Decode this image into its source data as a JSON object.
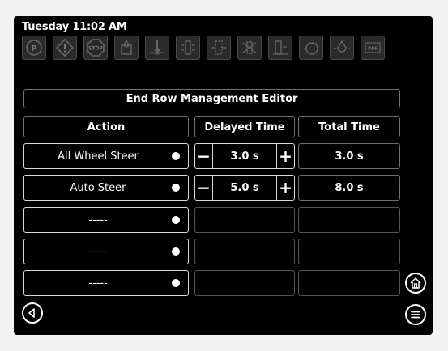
{
  "status": {
    "clock": "Tuesday 11:02 AM"
  },
  "indicators": [
    {
      "icon": "park-brake-icon"
    },
    {
      "icon": "warning-icon"
    },
    {
      "icon": "stop-icon",
      "text": "STOP"
    },
    {
      "icon": "hydraulic-oil-icon"
    },
    {
      "icon": "coolant-temp-icon"
    },
    {
      "icon": "filter-icon"
    },
    {
      "icon": "filter-restriction-icon"
    },
    {
      "icon": "air-filter-icon"
    },
    {
      "icon": "fuel-filter-icon"
    },
    {
      "icon": "engine-icon"
    },
    {
      "icon": "oil-pressure-icon"
    },
    {
      "icon": "def-icon",
      "text": "DEF"
    }
  ],
  "editor": {
    "title": "End Row Management Editor",
    "headers": {
      "action": "Action",
      "delayed": "Delayed Time",
      "total": "Total Time"
    },
    "rows": [
      {
        "action": "All Wheel Steer",
        "delay": "3.0 s",
        "total": "3.0 s"
      },
      {
        "action": "Auto Steer",
        "delay": "5.0 s",
        "total": "8.0 s"
      },
      {
        "action": "-----"
      },
      {
        "action": "-----"
      },
      {
        "action": "-----"
      }
    ],
    "minus": "−",
    "plus": "+"
  },
  "nav": {
    "back_icon": "back-arrow-icon",
    "home_icon": "home-icon",
    "menu_icon": "menu-icon"
  }
}
